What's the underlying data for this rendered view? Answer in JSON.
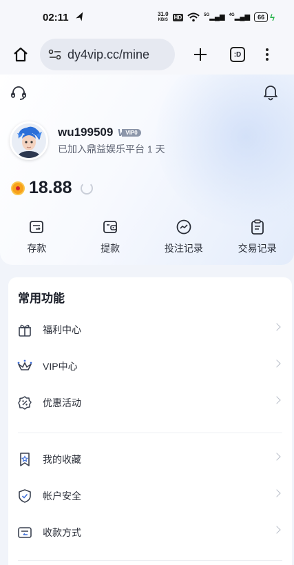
{
  "status_bar": {
    "time": "02:11",
    "net_speed_value": "31.0",
    "net_speed_unit": "KB/S",
    "hd_badge": "HD",
    "signal_1": "5G",
    "signal_2": "4G",
    "battery": "66"
  },
  "browser": {
    "url": "dy4vip.cc/mine",
    "tabs_label": ":D"
  },
  "profile": {
    "username": "wu199509",
    "vip_level": "VIP0",
    "joined_text": "已加入鼎益娱乐平台 1 天",
    "balance": "18.88"
  },
  "actions": [
    {
      "label": "存款",
      "icon": "deposit-icon"
    },
    {
      "label": "提款",
      "icon": "withdraw-icon"
    },
    {
      "label": "投注记录",
      "icon": "bet-record-icon"
    },
    {
      "label": "交易记录",
      "icon": "transaction-record-icon"
    }
  ],
  "functions": {
    "title": "常用功能",
    "items": [
      {
        "label": "福利中心",
        "icon": "gift-icon"
      },
      {
        "label": "VIP中心",
        "icon": "crown-icon"
      },
      {
        "label": "优惠活动",
        "icon": "discount-icon"
      },
      {
        "label": "我的收藏",
        "icon": "bookmark-icon"
      },
      {
        "label": "帐户安全",
        "icon": "shield-icon"
      },
      {
        "label": "收款方式",
        "icon": "card-icon"
      }
    ]
  },
  "colors": {
    "accent": "#3f6fd8",
    "icon_stroke": "#3a4150",
    "page_bg": "#f1f4fa"
  }
}
